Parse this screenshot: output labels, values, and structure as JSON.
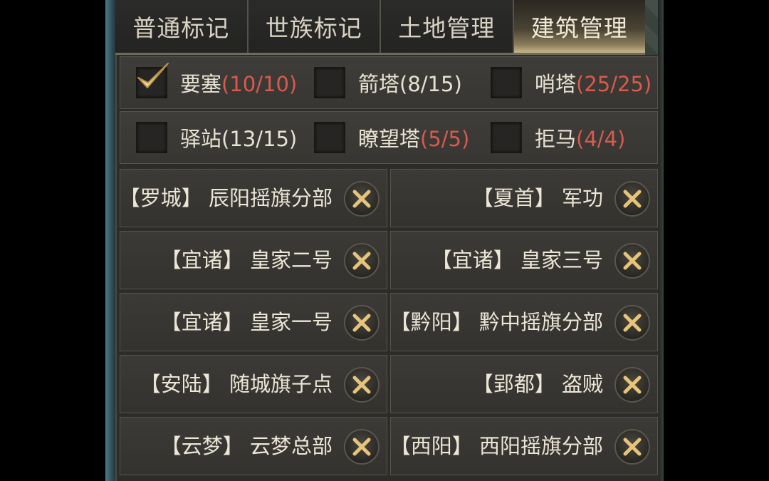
{
  "tabs": [
    {
      "label": "普通标记",
      "active": false
    },
    {
      "label": "世族标记",
      "active": false
    },
    {
      "label": "土地管理",
      "active": false
    },
    {
      "label": "建筑管理",
      "active": true
    }
  ],
  "filters": [
    {
      "name": "要塞",
      "count": "(10/10)",
      "checked": true,
      "full": true
    },
    {
      "name": "箭塔",
      "count": "(8/15)",
      "checked": false,
      "full": false
    },
    {
      "name": "哨塔",
      "count": "(25/25)",
      "checked": false,
      "full": true
    },
    {
      "name": "驿站",
      "count": "(13/15)",
      "checked": false,
      "full": false
    },
    {
      "name": "瞭望塔",
      "count": "(5/5)",
      "checked": false,
      "full": true
    },
    {
      "name": "拒马",
      "count": "(4/4)",
      "checked": false,
      "full": true
    }
  ],
  "markers": [
    {
      "region": "【罗城】",
      "name": "辰阳摇旗分部"
    },
    {
      "region": "【夏首】",
      "name": "军功"
    },
    {
      "region": "【宜诸】",
      "name": "皇家二号"
    },
    {
      "region": "【宜诸】",
      "name": "皇家三号"
    },
    {
      "region": "【宜诸】",
      "name": "皇家一号"
    },
    {
      "region": "【黔阳】",
      "name": "黔中摇旗分部"
    },
    {
      "region": "【安陆】",
      "name": "随城旗子点"
    },
    {
      "region": "【郢都】",
      "name": "盗贼"
    },
    {
      "region": "【云梦】",
      "name": "云梦总部"
    },
    {
      "region": "【西阳】",
      "name": "西阳摇旗分部"
    }
  ],
  "icons": {
    "checkmark": "checkmark-icon",
    "delete": "close-x-icon"
  },
  "colors": {
    "accent_gold": "#e6c47a",
    "count_full_red": "#d95a4c",
    "text_light": "#e8e2d3"
  }
}
